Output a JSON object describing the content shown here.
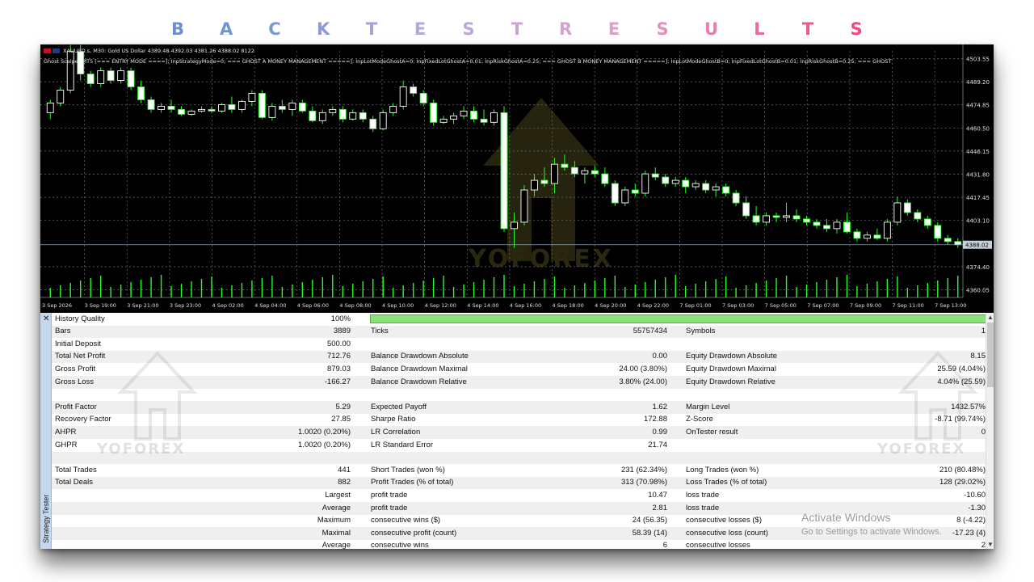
{
  "title_letters": [
    {
      "ch": "B",
      "color": "#6c8fd0"
    },
    {
      "ch": "A",
      "color": "#7194d2"
    },
    {
      "ch": "C",
      "color": "#7b98d4"
    },
    {
      "ch": "K",
      "color": "#8a9ad3"
    },
    {
      "ch": "T",
      "color": "#a2a5d4"
    },
    {
      "ch": "E",
      "color": "#b0aad8"
    },
    {
      "ch": "S",
      "color": "#bba7d8"
    },
    {
      "ch": "T",
      "color": "#c8a4d2"
    },
    {
      "ch": "R",
      "color": "#d4a4cc"
    },
    {
      "ch": "E",
      "color": "#df9fc6"
    },
    {
      "ch": "S",
      "color": "#e591bd"
    },
    {
      "ch": "U",
      "color": "#ea7eaf"
    },
    {
      "ch": "L",
      "color": "#ed6a9e"
    },
    {
      "ch": "T",
      "color": "#ef5a8d"
    },
    {
      "ch": "S",
      "color": "#f04a7c"
    }
  ],
  "chart": {
    "header": "XAUUSD.s, M30:  Gold US Dollar  4389.48 4392.03 4381.26 4388.02  8122",
    "params": "Ghost Scalper MT5 [=== ENTRY MODE ====]; InpStrategyMode=0; === GHOST A MONEY MANAGEMENT =====]; InpLotModeGhostA=0; InpFixedLotGhostA=0.01; InpRiskGhostA=0.25; === GHOST B MONEY MANAGEMENT =====]; InpLotModeGhostB=0; InpFixedLotGhostB=0.01; InpRiskGhostB=0.25; === GHOST",
    "current_price": "4388.02",
    "price_labels": [
      "4503.55",
      "4489.20",
      "4474.85",
      "4460.50",
      "4446.15",
      "4431.80",
      "4417.45",
      "4403.10",
      "4374.40",
      "4360.05"
    ],
    "time_labels": [
      "3 Sep 2026",
      "3 Sep 19:00",
      "3 Sep 21:00",
      "3 Sep 23:00",
      "4 Sep 02:00",
      "4 Sep 04:00",
      "4 Sep 06:00",
      "4 Sep 08:00",
      "4 Sep 10:00",
      "4 Sep 12:00",
      "4 Sep 14:00",
      "4 Sep 16:00",
      "4 Sep 18:00",
      "4 Sep 20:00",
      "4 Sep 22:00",
      "7 Sep 01:00",
      "7 Sep 03:00",
      "7 Sep 05:00",
      "7 Sep 07:00",
      "7 Sep 09:00",
      "7 Sep 11:00",
      "7 Sep 13:00"
    ],
    "watermark": "YOFOREX",
    "candles": [
      [
        4470,
        4478,
        4466,
        4476
      ],
      [
        4476,
        4486,
        4474,
        4484
      ],
      [
        4484,
        4512,
        4482,
        4508
      ],
      [
        4508,
        4512,
        4490,
        4494
      ],
      [
        4494,
        4496,
        4486,
        4488
      ],
      [
        4488,
        4498,
        4486,
        4496
      ],
      [
        4496,
        4498,
        4488,
        4490
      ],
      [
        4490,
        4498,
        4488,
        4496
      ],
      [
        4496,
        4498,
        4484,
        4486
      ],
      [
        4486,
        4490,
        4476,
        4478
      ],
      [
        4478,
        4480,
        4470,
        4472
      ],
      [
        4472,
        4476,
        4470,
        4474
      ],
      [
        4474,
        4478,
        4470,
        4472
      ],
      [
        4472,
        4474,
        4468,
        4469
      ],
      [
        4469,
        4472,
        4468,
        4471
      ],
      [
        4471,
        4474,
        4470,
        4472
      ],
      [
        4472,
        4474,
        4470,
        4471
      ],
      [
        4471,
        4476,
        4470,
        4475
      ],
      [
        4475,
        4480,
        4470,
        4472
      ],
      [
        4472,
        4478,
        4470,
        4477
      ],
      [
        4477,
        4484,
        4474,
        4482
      ],
      [
        4482,
        4484,
        4466,
        4467
      ],
      [
        4467,
        4476,
        4465,
        4474
      ],
      [
        4474,
        4478,
        4470,
        4472
      ],
      [
        4472,
        4478,
        4468,
        4476
      ],
      [
        4476,
        4478,
        4470,
        4471
      ],
      [
        4471,
        4474,
        4464,
        4465
      ],
      [
        4465,
        4472,
        4463,
        4470
      ],
      [
        4470,
        4474,
        4468,
        4472
      ],
      [
        4472,
        4474,
        4464,
        4466
      ],
      [
        4466,
        4472,
        4465,
        4470
      ],
      [
        4470,
        4472,
        4464,
        4466
      ],
      [
        4466,
        4468,
        4458,
        4460
      ],
      [
        4460,
        4472,
        4459,
        4470
      ],
      [
        4470,
        4476,
        4468,
        4474
      ],
      [
        4474,
        4490,
        4472,
        4486
      ],
      [
        4486,
        4488,
        4480,
        4482
      ],
      [
        4482,
        4484,
        4474,
        4476
      ],
      [
        4476,
        4478,
        4462,
        4464
      ],
      [
        4464,
        4468,
        4463,
        4466
      ],
      [
        4466,
        4470,
        4463,
        4468
      ],
      [
        4468,
        4474,
        4466,
        4471
      ],
      [
        4471,
        4474,
        4464,
        4466
      ],
      [
        4466,
        4472,
        4462,
        4464
      ],
      [
        4464,
        4472,
        4462,
        4470
      ],
      [
        4470,
        4474,
        4396,
        4398
      ],
      [
        4398,
        4408,
        4386,
        4402
      ],
      [
        4402,
        4425,
        4400,
        4422
      ],
      [
        4422,
        4432,
        4418,
        4428
      ],
      [
        4428,
        4436,
        4424,
        4426
      ],
      [
        4426,
        4442,
        4420,
        4438
      ],
      [
        4438,
        4444,
        4434,
        4436
      ],
      [
        4436,
        4440,
        4430,
        4432
      ],
      [
        4432,
        4436,
        4426,
        4434
      ],
      [
        4434,
        4437,
        4430,
        4432
      ],
      [
        4432,
        4436,
        4424,
        4426
      ],
      [
        4426,
        4428,
        4412,
        4414
      ],
      [
        4414,
        4424,
        4412,
        4422
      ],
      [
        4422,
        4426,
        4418,
        4420
      ],
      [
        4420,
        4434,
        4418,
        4432
      ],
      [
        4432,
        4436,
        4428,
        4430
      ],
      [
        4430,
        4432,
        4424,
        4426
      ],
      [
        4426,
        4430,
        4424,
        4428
      ],
      [
        4428,
        4430,
        4420,
        4424
      ],
      [
        4424,
        4428,
        4422,
        4426
      ],
      [
        4426,
        4428,
        4420,
        4422
      ],
      [
        4422,
        4426,
        4418,
        4424
      ],
      [
        4424,
        4426,
        4418,
        4420
      ],
      [
        4420,
        4422,
        4412,
        4414
      ],
      [
        4414,
        4418,
        4404,
        4406
      ],
      [
        4406,
        4412,
        4400,
        4402
      ],
      [
        4402,
        4408,
        4400,
        4406
      ],
      [
        4406,
        4408,
        4402,
        4405
      ],
      [
        4405,
        4414,
        4402,
        4406
      ],
      [
        4406,
        4410,
        4402,
        4404
      ],
      [
        4404,
        4406,
        4400,
        4402
      ],
      [
        4402,
        4404,
        4398,
        4400
      ],
      [
        4400,
        4404,
        4396,
        4398
      ],
      [
        4398,
        4404,
        4395,
        4402
      ],
      [
        4402,
        4408,
        4395,
        4396
      ],
      [
        4396,
        4398,
        4390,
        4392
      ],
      [
        4392,
        4396,
        4390,
        4394
      ],
      [
        4394,
        4398,
        4391,
        4392
      ],
      [
        4392,
        4404,
        4390,
        4402
      ],
      [
        4402,
        4418,
        4400,
        4414
      ],
      [
        4414,
        4416,
        4406,
        4408
      ],
      [
        4408,
        4410,
        4402,
        4404
      ],
      [
        4404,
        4406,
        4398,
        4400
      ],
      [
        4400,
        4402,
        4390,
        4392
      ],
      [
        4392,
        4394,
        4388,
        4390
      ],
      [
        4390,
        4392,
        4386,
        4388
      ]
    ],
    "colors": {
      "bg": "#000000",
      "grid": "#6e6e6e",
      "bull": "#ffffff",
      "bear": "#ffffff",
      "wick": "#22ff22",
      "volume": "#22ff22",
      "axis_text": "#e0e0e0",
      "price_line": "#8da0b4"
    }
  },
  "tester": {
    "side_label": "Strategy Tester",
    "history_quality_label": "History Quality",
    "history_quality_value": "100%",
    "history_quality_fill": 1.0,
    "rows": [
      {
        "c1": "Bars",
        "v1": "3889",
        "c2": "Ticks",
        "v2": "55757434",
        "c3": "Symbols",
        "v3": "1"
      },
      {
        "c1": "Initial Deposit",
        "v1": "500.00",
        "c2": "",
        "v2": "",
        "c3": "",
        "v3": ""
      },
      {
        "c1": "Total Net Profit",
        "v1": "712.76",
        "c2": "Balance Drawdown Absolute",
        "v2": "0.00",
        "c3": "Equity Drawdown Absolute",
        "v3": "8.15"
      },
      {
        "c1": "Gross Profit",
        "v1": "879.03",
        "c2": "Balance Drawdown Maximal",
        "v2": "24.00 (3.80%)",
        "c3": "Equity Drawdown Maximal",
        "v3": "25.59 (4.04%)"
      },
      {
        "c1": "Gross Loss",
        "v1": "-166.27",
        "c2": "Balance Drawdown Relative",
        "v2": "3.80% (24.00)",
        "c3": "Equity Drawdown Relative",
        "v3": "4.04% (25.59)"
      },
      {
        "c1": "",
        "v1": "",
        "c2": "",
        "v2": "",
        "c3": "",
        "v3": ""
      },
      {
        "c1": "Profit Factor",
        "v1": "5.29",
        "c2": "Expected Payoff",
        "v2": "1.62",
        "c3": "Margin Level",
        "v3": "1432.57%"
      },
      {
        "c1": "Recovery Factor",
        "v1": "27.85",
        "c2": "Sharpe Ratio",
        "v2": "172.88",
        "c3": "Z-Score",
        "v3": "-8.71 (99.74%)"
      },
      {
        "c1": "AHPR",
        "v1": "1.0020 (0.20%)",
        "c2": "LR Correlation",
        "v2": "0.99",
        "c3": "OnTester result",
        "v3": "0"
      },
      {
        "c1": "GHPR",
        "v1": "1.0020 (0.20%)",
        "c2": "LR Standard Error",
        "v2": "21.74",
        "c3": "",
        "v3": ""
      },
      {
        "c1": "",
        "v1": "",
        "c2": "",
        "v2": "",
        "c3": "",
        "v3": ""
      },
      {
        "c1": "Total Trades",
        "v1": "441",
        "c2": "Short Trades (won %)",
        "v2": "231 (62.34%)",
        "c3": "Long Trades (won %)",
        "v3": "210 (80.48%)"
      },
      {
        "c1": "Total Deals",
        "v1": "882",
        "c2": "Profit Trades (% of total)",
        "v2": "313 (70.98%)",
        "c3": "Loss Trades (% of total)",
        "v3": "128 (29.02%)"
      },
      {
        "c1": "",
        "v1": "Largest",
        "c2": "profit trade",
        "v2": "10.47",
        "c3": "loss trade",
        "v3": "-10.60"
      },
      {
        "c1": "",
        "v1": "Average",
        "c2": "profit trade",
        "v2": "2.81",
        "c3": "loss trade",
        "v3": "-1.30"
      },
      {
        "c1": "",
        "v1": "Maximum",
        "c2": "consecutive wins ($)",
        "v2": "24 (56.35)",
        "c3": "consecutive losses ($)",
        "v3": "8 (-4.22)"
      },
      {
        "c1": "",
        "v1": "Maximal",
        "c2": "consecutive profit (count)",
        "v2": "58.39 (14)",
        "c3": "consecutive loss (count)",
        "v3": "-17.23 (4)"
      },
      {
        "c1": "",
        "v1": "Average",
        "c2": "consecutive wins",
        "v2": "6",
        "c3": "consecutive losses",
        "v3": "2"
      }
    ],
    "watermark": "YOFOREX"
  },
  "os_notice": {
    "line1": "Activate Windows",
    "line2": "Go to Settings to activate Windows."
  }
}
